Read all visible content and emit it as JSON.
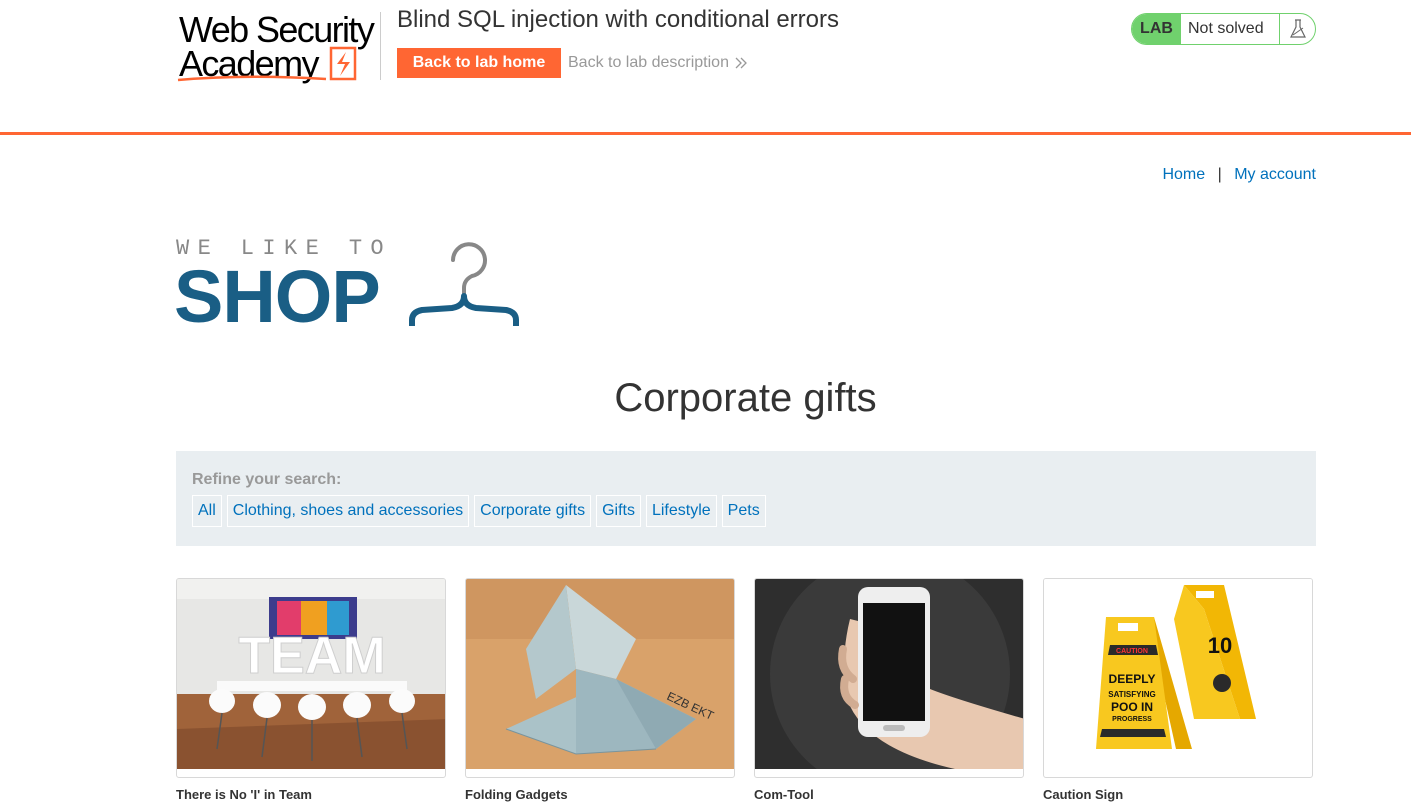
{
  "academy": {
    "logo_line1": "Web Security",
    "logo_line2": "Academy",
    "lab_title": "Blind SQL injection with conditional errors",
    "back_home_label": "Back to lab home",
    "back_desc_label": "Back to lab description",
    "status_badge": "LAB",
    "status_text": "Not solved",
    "colors": {
      "accent": "#ff6633",
      "status_green": "#70d16d"
    }
  },
  "shop": {
    "nav": {
      "home": "Home",
      "separator": "|",
      "my_account": "My account"
    },
    "logo": {
      "tagline": "WE LIKE TO",
      "word": "SHOP",
      "icon": "hanger-icon",
      "color": "#1a5e85"
    },
    "page_title": "Corporate gifts",
    "filters": {
      "label": "Refine your search:",
      "items": [
        "All",
        "Clothing, shoes and accessories",
        "Corporate gifts",
        "Gifts",
        "Lifestyle",
        "Pets"
      ]
    },
    "products": [
      {
        "name": "There is No 'I' in Team",
        "image": "team-office-photo"
      },
      {
        "name": "Folding Gadgets",
        "image": "paper-plane-photo"
      },
      {
        "name": "Com-Tool",
        "image": "phone-in-hand-photo"
      },
      {
        "name": "Caution Sign",
        "image": "caution-sign-photo"
      }
    ]
  }
}
